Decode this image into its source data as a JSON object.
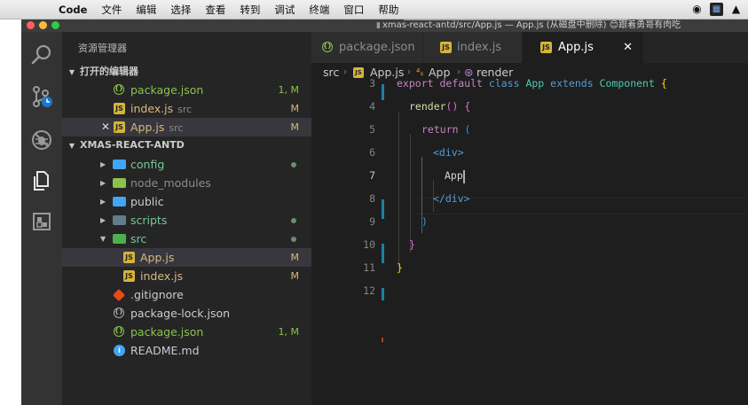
{
  "menubar": {
    "app_name": "Code",
    "items": [
      "文件",
      "编辑",
      "选择",
      "查看",
      "转到",
      "调试",
      "终端",
      "窗口",
      "帮助"
    ]
  },
  "window": {
    "title": "xmas-react-antd/src/App.js — App.js (从磁盘中删除) 😊跟着勇哥有肉吃"
  },
  "activity_bar": {
    "icons": [
      "search-icon",
      "source-control-icon",
      "debug-icon",
      "explorer-icon",
      "extensions-icon"
    ]
  },
  "sidebar": {
    "title": "资源管理器",
    "open_editors": {
      "header": "打开的编辑器",
      "items": [
        {
          "name": "package.json",
          "sub": "",
          "badge": "1, M",
          "color": "#8bc34a",
          "icon": "json"
        },
        {
          "name": "index.js",
          "sub": "src",
          "badge": "M",
          "color": "#d7ba7d",
          "icon": "js"
        },
        {
          "name": "App.js",
          "sub": "src",
          "badge": "M",
          "color": "#d7ba7d",
          "icon": "js",
          "close": "✕"
        }
      ]
    },
    "project": {
      "header": "XMAS-REACT-ANTD",
      "items": [
        {
          "name": "config",
          "color": "#73c991",
          "icon": "folder",
          "folder_color": "#42a5f5"
        },
        {
          "name": "node_modules",
          "color": "#8c8c8c",
          "icon": "folder",
          "folder_color": "#8bc34a"
        },
        {
          "name": "public",
          "color": "#cccccc",
          "icon": "folder",
          "folder_color": "#42a5f5"
        },
        {
          "name": "scripts",
          "color": "#73c991",
          "icon": "folder",
          "folder_color": "#607d8b"
        },
        {
          "name": "src",
          "color": "#73c991",
          "icon": "folder-open",
          "folder_color": "#4caf50"
        },
        {
          "name": "App.js",
          "badge": "M",
          "color": "#d7ba7d",
          "icon": "js"
        },
        {
          "name": "index.js",
          "badge": "M",
          "color": "#d7ba7d",
          "icon": "js"
        },
        {
          "name": ".gitignore",
          "color": "#cccccc",
          "icon": "git"
        },
        {
          "name": "package-lock.json",
          "color": "#cccccc",
          "icon": "json"
        },
        {
          "name": "package.json",
          "badge": "1, M",
          "color": "#8bc34a",
          "icon": "json"
        },
        {
          "name": "README.md",
          "color": "#cccccc",
          "icon": "info"
        }
      ]
    }
  },
  "editor": {
    "tabs": [
      {
        "label": "package.json",
        "active": false
      },
      {
        "label": "index.js",
        "active": false
      },
      {
        "label": "App.js",
        "active": true,
        "close": "✕"
      }
    ],
    "breadcrumb": [
      "src",
      "App.js",
      "App",
      "render"
    ],
    "code": {
      "line_numbers": [
        "3",
        "4",
        "5",
        "6",
        "7",
        "8",
        "9",
        "10",
        "11",
        "12"
      ],
      "line3": {
        "kw1": "export",
        "kw2": "default",
        "kw3": "class",
        "name": "App",
        "kw4": "extends",
        "base": "Component",
        "brace": "{"
      },
      "line4": {
        "fn": "render",
        "parens": "()",
        "brace": "{"
      },
      "line5": {
        "kw": "return",
        "paren": "("
      },
      "line6": {
        "tag": "<div>"
      },
      "line7": {
        "text": "App"
      },
      "line8": {
        "tag": "</div>"
      },
      "line9": {
        "paren": ")"
      },
      "line10": {
        "brace": "}"
      },
      "line11": {
        "brace": "}"
      }
    }
  }
}
